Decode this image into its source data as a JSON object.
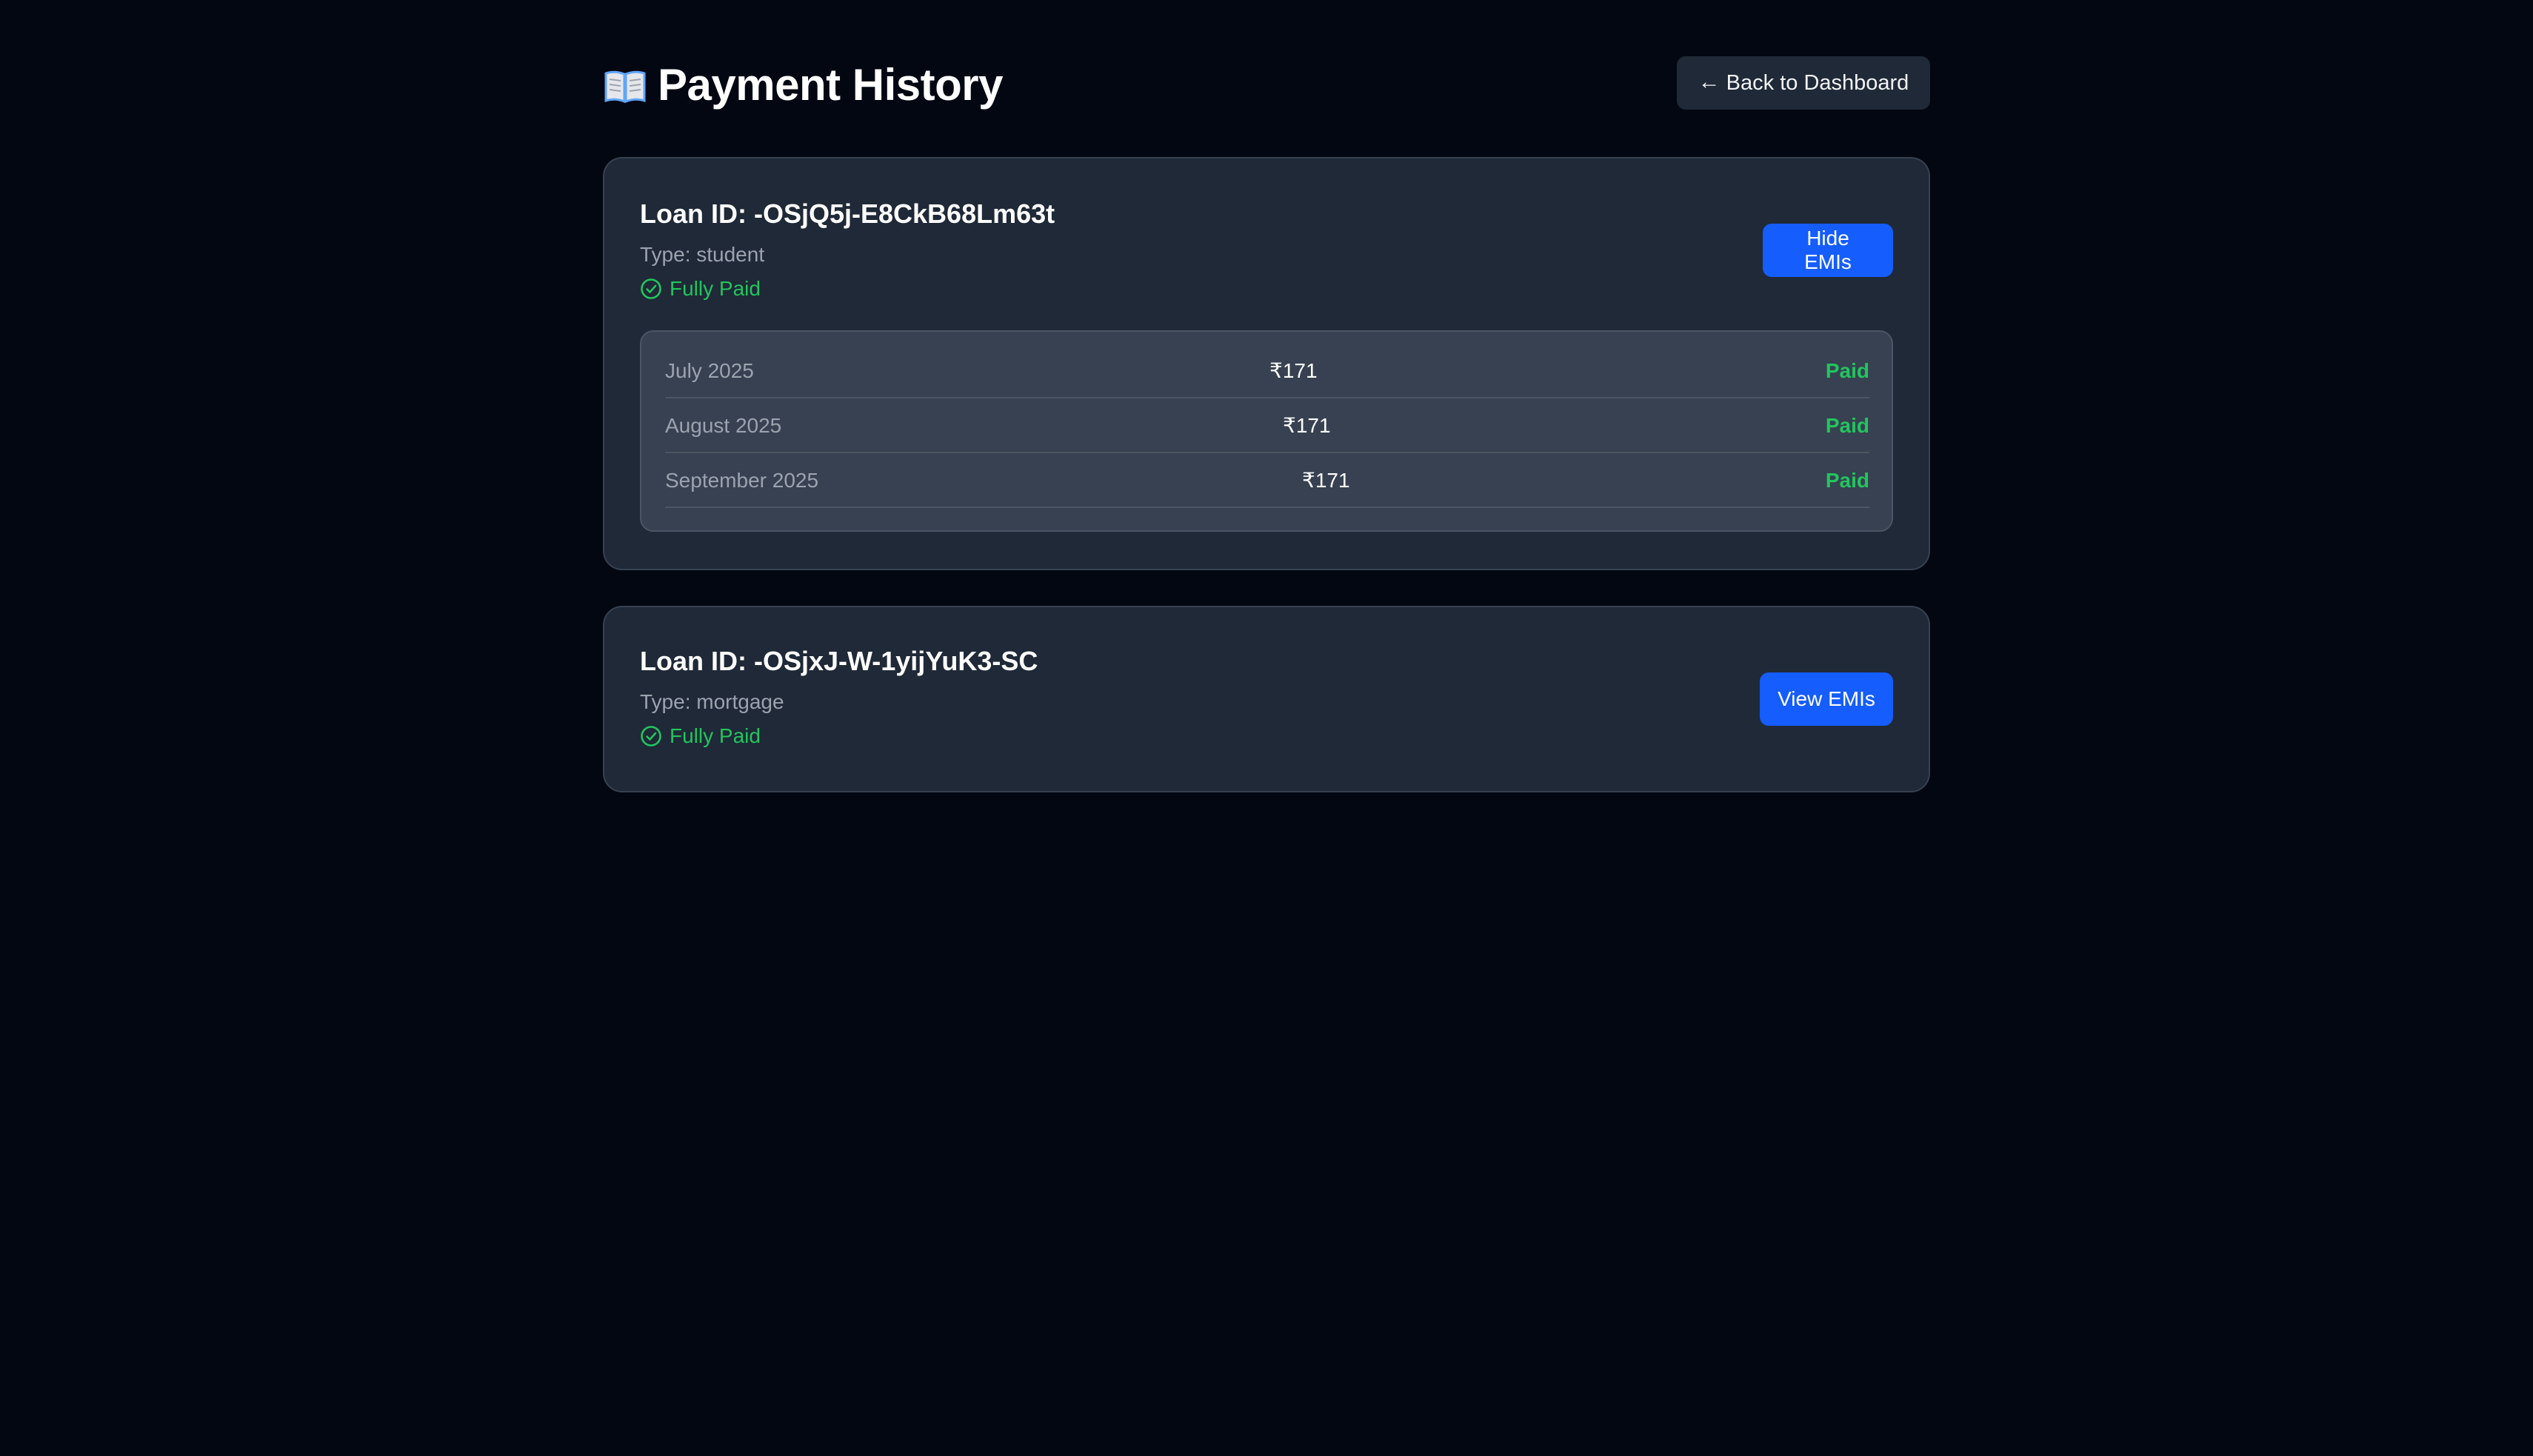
{
  "header": {
    "title": "Payment History",
    "title_icon": "book-icon",
    "back_label": "Back to Dashboard",
    "back_icon": "arrow-left-icon"
  },
  "colors": {
    "page_bg": "#030712",
    "card_bg": "#1f2937",
    "table_bg": "#374151",
    "accent_blue": "#155dfc",
    "paid_green": "#22c55e",
    "muted_text": "#9ca3af"
  },
  "loans": [
    {
      "id_label": "Loan ID: -OSjQ5j-E8CkB68Lm63t",
      "type_label": "Type: student",
      "status_label": "Fully Paid",
      "status_icon": "check-circle-icon",
      "button_label": "Hide EMIs",
      "emis": [
        {
          "month": "July 2025",
          "amount": "₹171",
          "status": "Paid"
        },
        {
          "month": "August 2025",
          "amount": "₹171",
          "status": "Paid"
        },
        {
          "month": "September 2025",
          "amount": "₹171",
          "status": "Paid"
        }
      ]
    },
    {
      "id_label": "Loan ID: -OSjxJ-W-1yijYuK3-SC",
      "type_label": "Type: mortgage",
      "status_label": "Fully Paid",
      "status_icon": "check-circle-icon",
      "button_label": "View EMIs"
    }
  ]
}
